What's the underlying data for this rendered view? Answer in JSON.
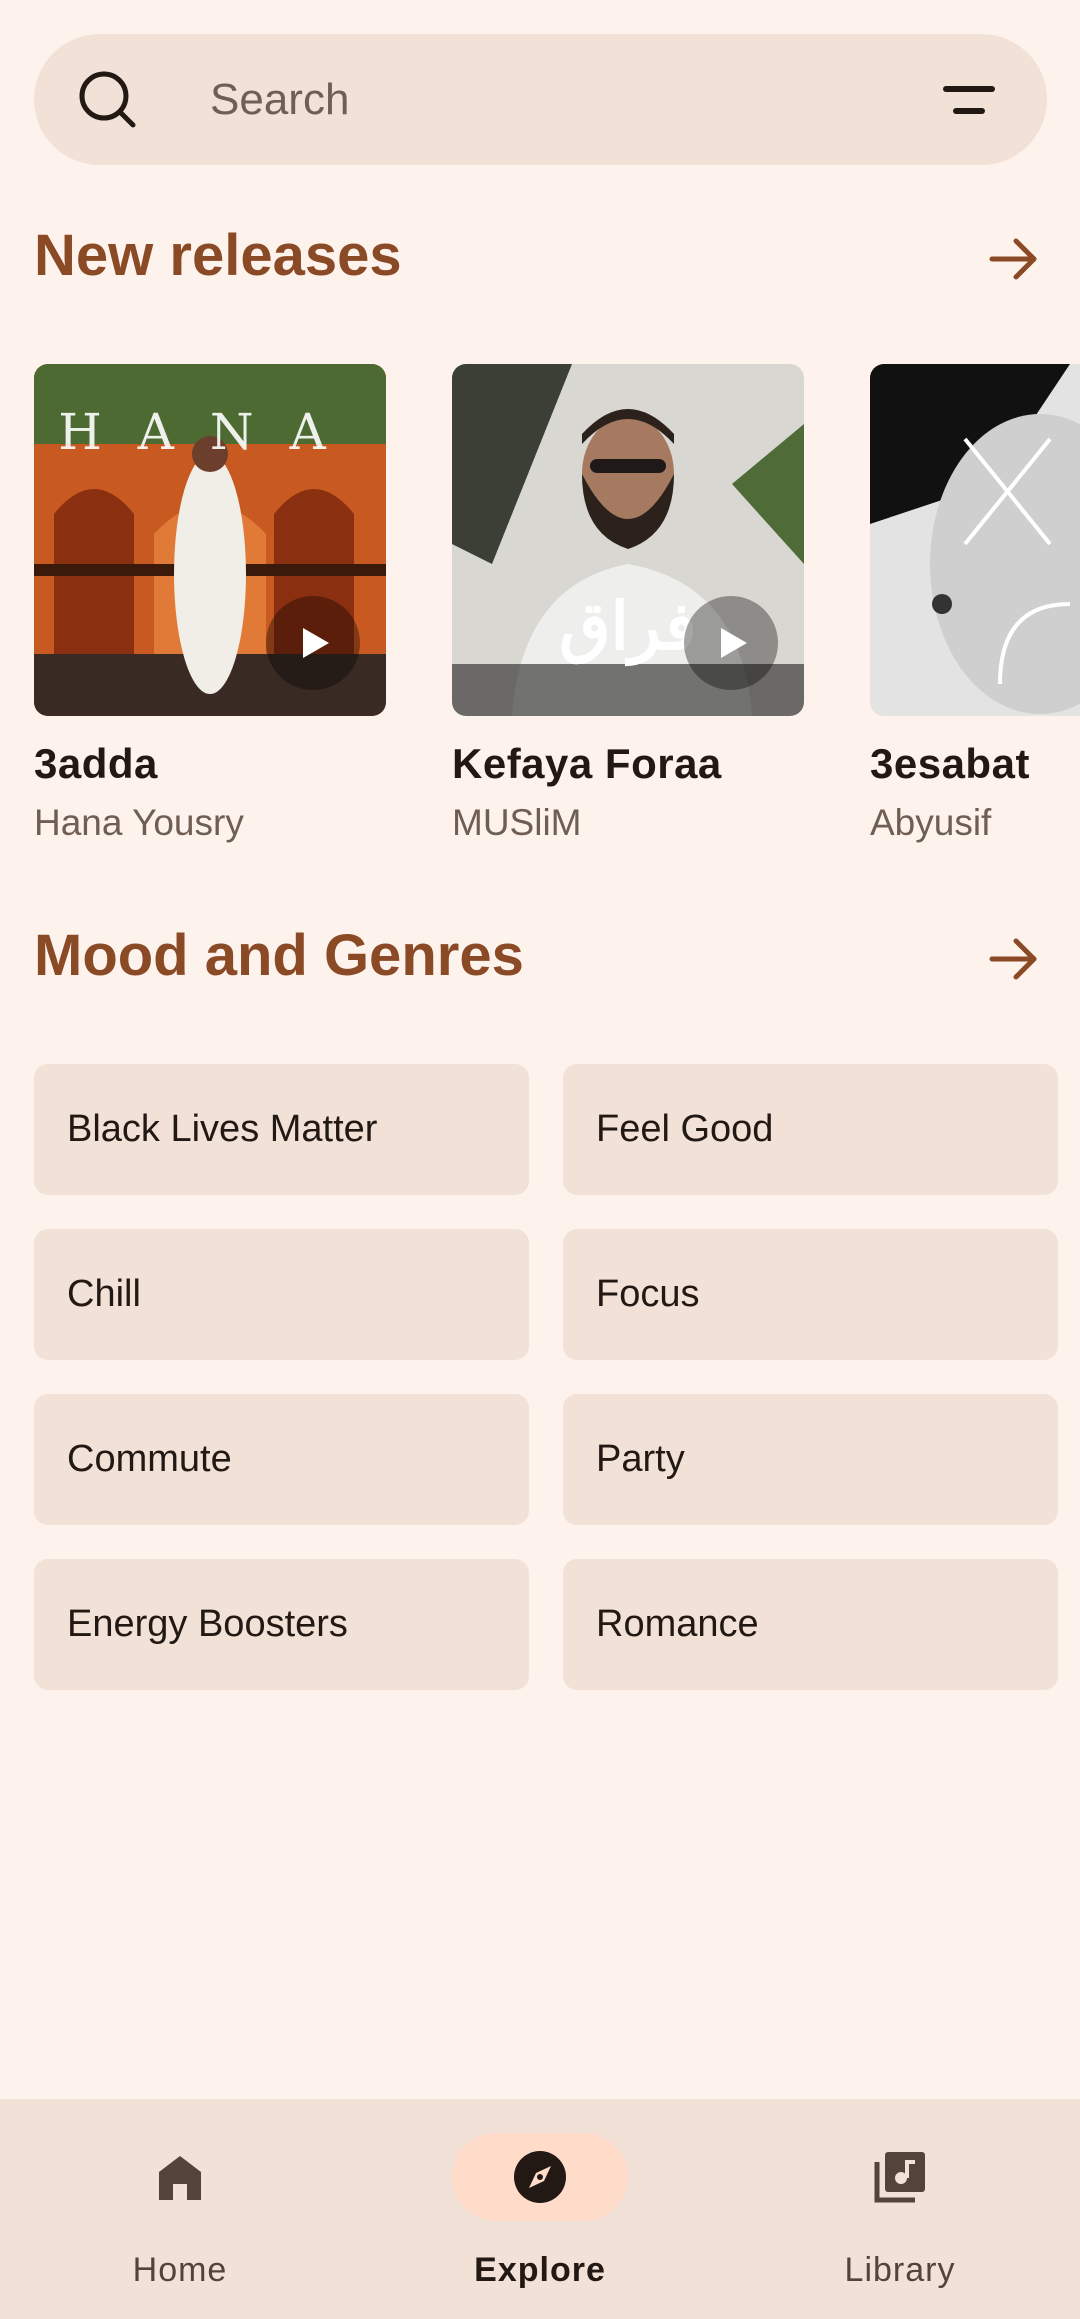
{
  "search": {
    "placeholder": "Search",
    "icon": "search-icon",
    "filter_icon": "filter-icon"
  },
  "new_releases": {
    "title": "New releases",
    "items": [
      {
        "title": "3adda",
        "artist": "Hana Yousry"
      },
      {
        "title": "Kefaya Foraa",
        "artist": "MUSliM"
      },
      {
        "title": "3esabat",
        "artist": "Abyusif"
      }
    ]
  },
  "moods": {
    "title": "Mood and Genres",
    "items": [
      {
        "label": "Black Lives Matter"
      },
      {
        "label": "Feel Good"
      },
      {
        "label": "Chill"
      },
      {
        "label": "Focus"
      },
      {
        "label": "Commute"
      },
      {
        "label": "Party"
      },
      {
        "label": "Energy Boosters"
      },
      {
        "label": "Romance"
      }
    ]
  },
  "nav": {
    "items": [
      {
        "label": "Home",
        "icon": "home-icon",
        "active": false
      },
      {
        "label": "Explore",
        "icon": "explore-icon",
        "active": true
      },
      {
        "label": "Library",
        "icon": "library-icon",
        "active": false
      }
    ]
  },
  "colors": {
    "background": "#fdf3ec",
    "surface": "#f2e1d6",
    "accent": "#8b4a26",
    "active_pill": "#ffdbc9"
  }
}
